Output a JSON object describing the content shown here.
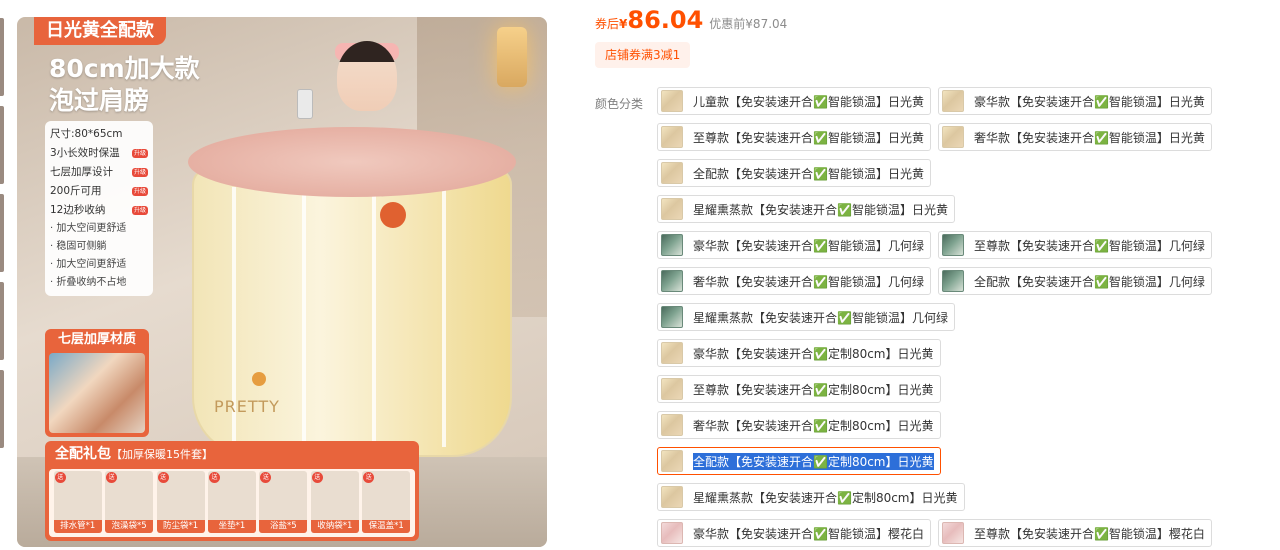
{
  "product_image": {
    "flag": "日光黄全配款",
    "headline_1": "80cm加大款",
    "headline_2": "泡过肩膀",
    "specs": [
      {
        "text": "尺寸:80*65cm",
        "badge": ""
      },
      {
        "text": "3小长效时保温",
        "badge": "升级"
      },
      {
        "text": "七层加厚设计",
        "badge": "升级"
      },
      {
        "text": "200斤可用",
        "badge": "升级"
      },
      {
        "text": "12边秒收纳",
        "badge": "升级"
      }
    ],
    "spec_notes": [
      "· 加大空间更舒适",
      "· 稳固可侧躺",
      "· 加大空间更舒适",
      "· 折叠收纳不占地"
    ],
    "material_caption": "七层加厚材质",
    "tub_brand": "PRETTY",
    "gift_title": "全配礼包",
    "gift_subtitle": "【加厚保暖15件套】",
    "gift_badge": "送",
    "gifts": [
      "排水管*1",
      "泡澡袋*5",
      "防尘袋*1",
      "坐垫*1",
      "浴盐*5",
      "收纳袋*1",
      "保温盖*1"
    ]
  },
  "price": {
    "label": "券后",
    "currency": "¥",
    "value": "86.04",
    "original": "优惠前¥87.04"
  },
  "coupon": "店铺券满3减1",
  "sku": {
    "label": "颜色分类",
    "selected_index": 11,
    "options": [
      {
        "text": "儿童款【免安装速开合✅智能锁温】日光黄",
        "thumb": "yellow"
      },
      {
        "text": "豪华款【免安装速开合✅智能锁温】日光黄",
        "thumb": "yellow"
      },
      {
        "text": "至尊款【免安装速开合✅智能锁温】日光黄",
        "thumb": "yellow"
      },
      {
        "text": "奢华款【免安装速开合✅智能锁温】日光黄",
        "thumb": "yellow"
      },
      {
        "text": "全配款【免安装速开合✅智能锁温】日光黄",
        "thumb": "yellow"
      },
      {
        "text": "星耀熏蒸款【免安装速开合✅智能锁温】日光黄",
        "thumb": "yellow"
      },
      {
        "text": "豪华款【免安装速开合✅智能锁温】几何绿",
        "thumb": "green"
      },
      {
        "text": "至尊款【免安装速开合✅智能锁温】几何绿",
        "thumb": "green"
      },
      {
        "text": "奢华款【免安装速开合✅智能锁温】几何绿",
        "thumb": "green"
      },
      {
        "text": "全配款【免安装速开合✅智能锁温】几何绿",
        "thumb": "green"
      },
      {
        "text": "星耀熏蒸款【免安装速开合✅智能锁温】几何绿",
        "thumb": "green"
      },
      {
        "text": "豪华款【免安装速开合✅定制80cm】日光黄",
        "thumb": "yellow"
      },
      {
        "text": "至尊款【免安装速开合✅定制80cm】日光黄",
        "thumb": "yellow"
      },
      {
        "text": "奢华款【免安装速开合✅定制80cm】日光黄",
        "thumb": "yellow"
      },
      {
        "text": "全配款【免安装速开合✅定制80cm】日光黄",
        "thumb": "yellow"
      },
      {
        "text": "星耀熏蒸款【免安装速开合✅定制80cm】日光黄",
        "thumb": "yellow"
      },
      {
        "text": "豪华款【免安装速开合✅智能锁温】樱花白",
        "thumb": "pink"
      },
      {
        "text": "至尊款【免安装速开合✅智能锁温】樱花白",
        "thumb": "pink"
      }
    ]
  },
  "colors": {
    "accent": "#ff5000",
    "banner": "#e8643c",
    "selection": "#2d6fd9"
  }
}
